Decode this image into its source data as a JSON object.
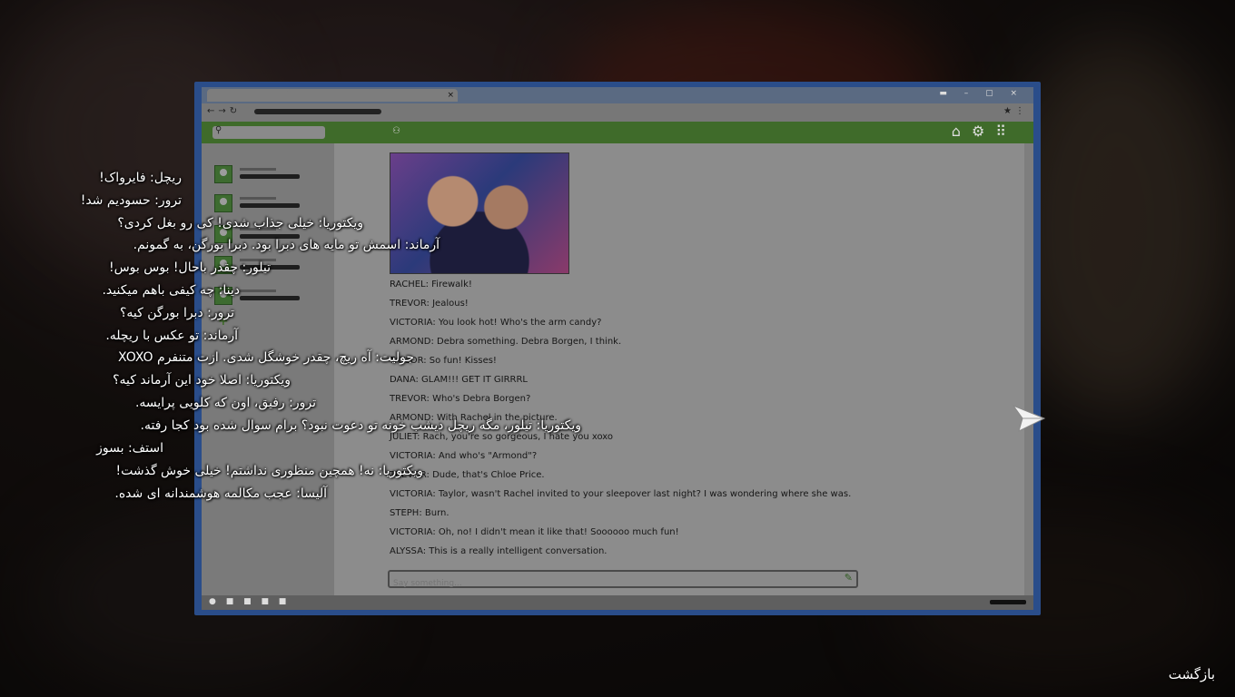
{
  "browser": {
    "tabs": [
      "",
      "",
      ""
    ],
    "search_placeholder": "",
    "input_placeholder": "Say something..."
  },
  "chat_messages": [
    "RACHEL: Firewalk!",
    "TREVOR: Jealous!",
    "VICTORIA: You look hot! Who's the arm candy?",
    "ARMOND: Debra something. Debra Borgen, I think.",
    "TAYLOR: So fun! Kisses!",
    "DANA: GLAM!!! GET IT GIRRRL",
    "TREVOR: Who's Debra Borgen?",
    "ARMOND: With Rachel in the picture.",
    "JULIET: Rach, you're so gorgeous, I hate you xoxo",
    "VICTORIA: And who's \"Armond\"?",
    "TREVOR: Dude, that's Chloe Price.",
    "VICTORIA: Taylor, wasn't Rachel invited to your sleepover last night? I was wondering where she was.",
    "STEPH: Burn.",
    "VICTORIA: Oh, no! I didn't mean it like that! Soooooo much fun!",
    "ALYSSA: This is a really intelligent conversation."
  ],
  "subtitles": [
    "ریچل: فایرواک!",
    "ترور: حسودیم شد!",
    "ویکتوریا: خیلی جذاب شدی! کی رو بغل کردی؟",
    "آرماند: اسمش تو مایه های دبرا بود. دبرا بورگن، به گمونم.",
    "تیلور: چقدر باحال! بوس بوس!",
    "دینا: چه کیفی باهم میکنید.",
    "ترور: دبرا بورگن کیه؟",
    "آرماند: تو عکس با ریچله.",
    "جولیت: آه ریچ، چقدر خوشگل شدی. ازت متنفرم XOXO",
    "ویکتوریا: اصلا خود این آرماند کیه؟",
    "ترور: رفیق، اون که کلویی پرایسه.",
    "ویکتوریا: تیلور، مگه ریچل دیشب خونه تو دعوت نبود؟ برام سوال شده بود کجا رفته.",
    "استف: بسوز",
    "ویکتوریا: نه! همچین منظوری نداشتم! خیلی خوش گذشت!",
    "آلیسا: عجب مکالمه هوشمندانه ای شده."
  ],
  "back_label": "بازگشت",
  "colors": {
    "screen_frame": "#2a4d8a",
    "app_bar": "#3f6b2a",
    "subtitle_text": "#ffffff"
  }
}
